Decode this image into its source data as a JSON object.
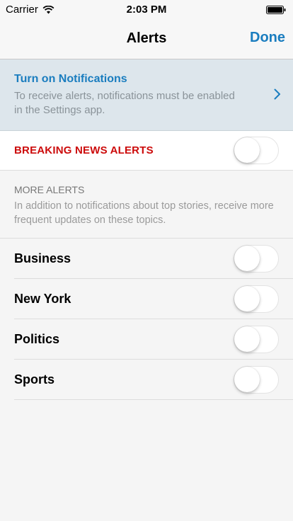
{
  "status_bar": {
    "carrier": "Carrier",
    "time": "2:03 PM",
    "wifi_icon": "wifi-icon",
    "battery_icon": "battery-full-icon"
  },
  "nav": {
    "title": "Alerts",
    "done_label": "Done"
  },
  "notifications_banner": {
    "title": "Turn on Notifications",
    "description": "To receive alerts, notifications must be enabled in the Settings app.",
    "icon": "chevron-right-icon"
  },
  "breaking_news": {
    "label": "BREAKING NEWS ALERTS",
    "enabled": false
  },
  "more_alerts": {
    "heading": "MORE ALERTS",
    "description": "In addition to notifications about top stories, receive more frequent updates on these topics."
  },
  "topics": [
    {
      "label": "Business",
      "enabled": false
    },
    {
      "label": "New York",
      "enabled": false
    },
    {
      "label": "Politics",
      "enabled": false
    },
    {
      "label": "Sports",
      "enabled": false
    }
  ],
  "colors": {
    "accent": "#1a7dbf",
    "breaking": "#cc0a0a",
    "banner_bg": "#dde6ec",
    "page_bg": "#f5f5f5"
  }
}
